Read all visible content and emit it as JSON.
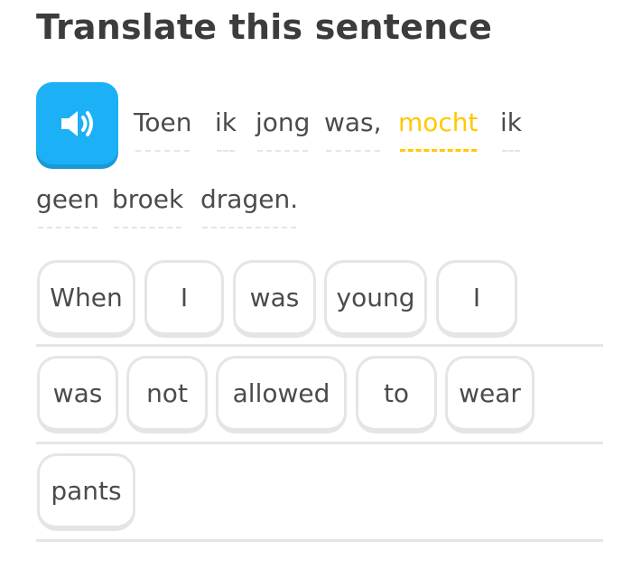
{
  "header": {
    "title": "Translate this sentence"
  },
  "prompt": {
    "speaker_icon": "speaker-icon",
    "accent_color": "#1cb0f6",
    "highlight_color": "#ffc800",
    "words": [
      "Toen",
      "ik",
      "jong",
      "was,",
      "mocht",
      "ik",
      "geen",
      "broek",
      "dragen."
    ],
    "highlighted_word": "mocht"
  },
  "answer": {
    "tiles": [
      "When",
      "I",
      "was",
      "young",
      "I",
      "was",
      "not",
      "allowed",
      "to",
      "wear",
      "pants"
    ]
  }
}
